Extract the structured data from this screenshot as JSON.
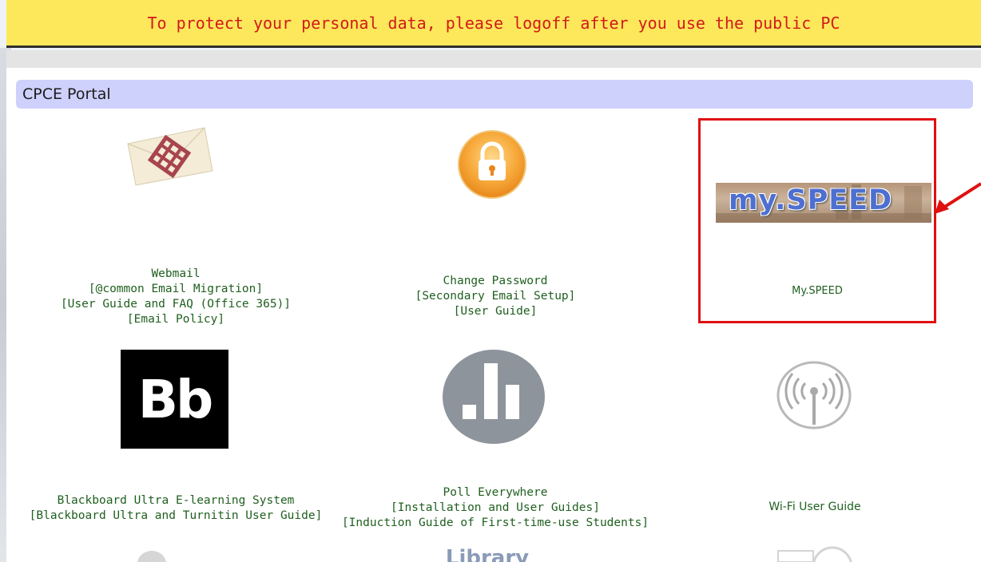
{
  "banner": {
    "text": "To protect your personal data, please logoff after you use the public PC"
  },
  "portal": {
    "title": "CPCE Portal"
  },
  "tiles": {
    "webmail": {
      "icon": "envelope-icon",
      "lines": [
        "Webmail",
        "[@common Email Migration]",
        "[User Guide and FAQ (Office 365)]",
        "[Email Policy]"
      ]
    },
    "password": {
      "icon": "padlock-icon",
      "lines": [
        "Change Password",
        "[Secondary Email Setup]",
        "[User Guide]"
      ]
    },
    "myspeed": {
      "icon": "myspeed-logo",
      "logo_text": "my.SPEED",
      "label": "My.SPEED"
    },
    "blackboard": {
      "icon": "blackboard-icon",
      "logo_text": "Bb",
      "lines": [
        "Blackboard Ultra E-learning System",
        "[Blackboard Ultra and Turnitin User Guide]"
      ]
    },
    "poll": {
      "icon": "bar-chart-icon",
      "lines": [
        "Poll Everywhere",
        "[Installation and User Guides]",
        "[Induction Guide of First-time-use Students]"
      ]
    },
    "wifi": {
      "icon": "wifi-signal-icon",
      "lines": [
        "Wi-Fi User Guide"
      ]
    },
    "library": {
      "logo_text": "Library"
    }
  },
  "colors": {
    "banner_bg": "#fce85a",
    "banner_text": "#d31a1a",
    "portal_bar": "#cdd1fb",
    "link_text": "#1f5f1f",
    "highlight": "#e01010"
  }
}
